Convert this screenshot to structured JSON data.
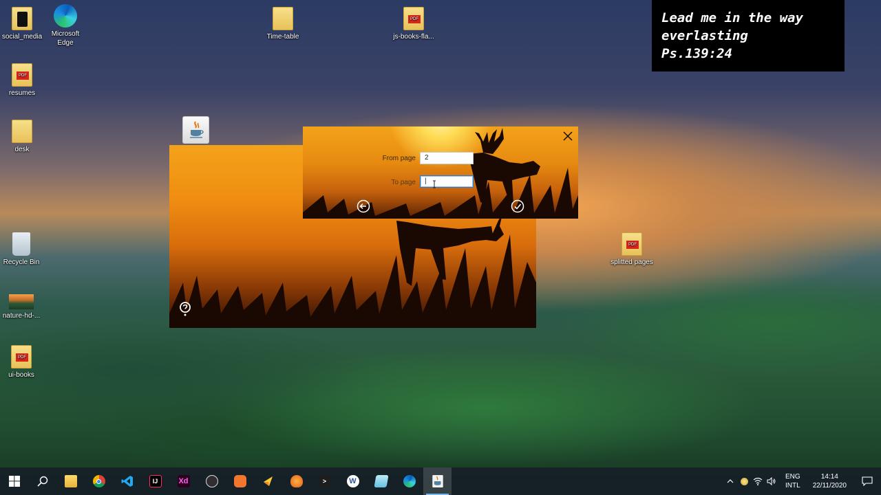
{
  "desktop": {
    "icons": [
      {
        "label": "social_media"
      },
      {
        "label": "Microsoft Edge"
      },
      {
        "label": "Time-table"
      },
      {
        "label": "js-books-fla..."
      },
      {
        "label": "resumes"
      },
      {
        "label": "desk"
      },
      {
        "label": "Recycle Bin"
      },
      {
        "label": "nature-hd-..."
      },
      {
        "label": "ui-books"
      },
      {
        "label": "splitted pages"
      }
    ]
  },
  "quote": {
    "line1": "Lead me in the way",
    "line2": "everlasting",
    "line3": "Ps.139:24"
  },
  "dialog": {
    "from_label": "From page",
    "from_value": "2",
    "to_label": "To page",
    "to_value": "|",
    "back_icon": "arrow-left-circle-icon",
    "confirm_icon": "check-circle-icon",
    "close_icon": "close-icon"
  },
  "taskbar": {
    "apps": [
      "windows-start",
      "search",
      "file-explorer",
      "chrome",
      "vscode",
      "intellij",
      "adobe-xd",
      "obs",
      "brave",
      "kite",
      "fl-studio",
      "powershell",
      "word",
      "notepad",
      "edge",
      "java"
    ],
    "tray": {
      "lang_top": "ENG",
      "lang_bottom": "INTL",
      "time": "14:14",
      "date": "22/11/2020"
    }
  },
  "colors": {
    "taskbar": "#16202a",
    "dialog_orange": "#f4a21a",
    "accent_blue": "#2a7bd3"
  }
}
